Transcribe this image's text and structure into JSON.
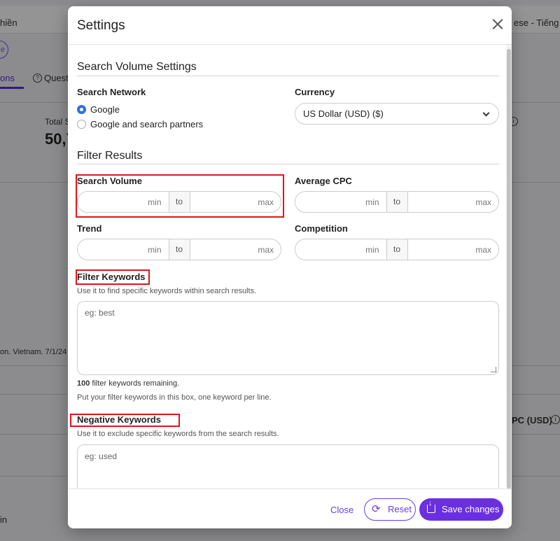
{
  "background": {
    "topbar_left_text": "hiền",
    "topbar_right_text": "ese - Tiếng V",
    "chip_text": "e",
    "tab_active": "ons",
    "tab_question": "Quest",
    "question_icon": "?",
    "total_label": "Total S",
    "total_value": "50,7",
    "info_icon": "i",
    "footnote": "on. Vietnam. 7/1/24",
    "cpc_header": "PC (USD)",
    "row_text": "in"
  },
  "modal": {
    "title": "Settings",
    "search_volume_settings": {
      "heading": "Search Volume Settings",
      "network_label": "Search Network",
      "network_options": [
        "Google",
        "Google and search partners"
      ],
      "network_selected": "Google",
      "currency_label": "Currency",
      "currency_value": "US Dollar (USD) ($)"
    },
    "filter_results": {
      "heading": "Filter Results",
      "search_volume": {
        "label": "Search Volume",
        "min_placeholder": "min",
        "to": "to",
        "max_placeholder": "max"
      },
      "average_cpc": {
        "label": "Average CPC",
        "min_placeholder": "min",
        "to": "to",
        "max_placeholder": "max"
      },
      "trend": {
        "label": "Trend",
        "min_placeholder": "min",
        "to": "to",
        "max_placeholder": "max"
      },
      "competition": {
        "label": "Competition",
        "min_placeholder": "min",
        "to": "to",
        "max_placeholder": "max"
      }
    },
    "filter_keywords": {
      "label": "Filter Keywords",
      "help": "Use it to find specific keywords within search results.",
      "placeholder": "eg: best",
      "remaining_count": "100",
      "remaining_text": " filter keywords remaining.",
      "hint": "Put your filter keywords in this box, one keyword per line."
    },
    "negative_keywords": {
      "label": "Negative Keywords",
      "help": "Use it to exclude specific keywords from the search results.",
      "placeholder": "eg: used"
    },
    "footer": {
      "close_label": "Close",
      "reset_label": "Reset",
      "save_label": "Save changes"
    }
  },
  "colors": {
    "accent": "#6a2fe0",
    "highlight_box": "#e0151a",
    "radio_checked": "#2f6fe6"
  }
}
